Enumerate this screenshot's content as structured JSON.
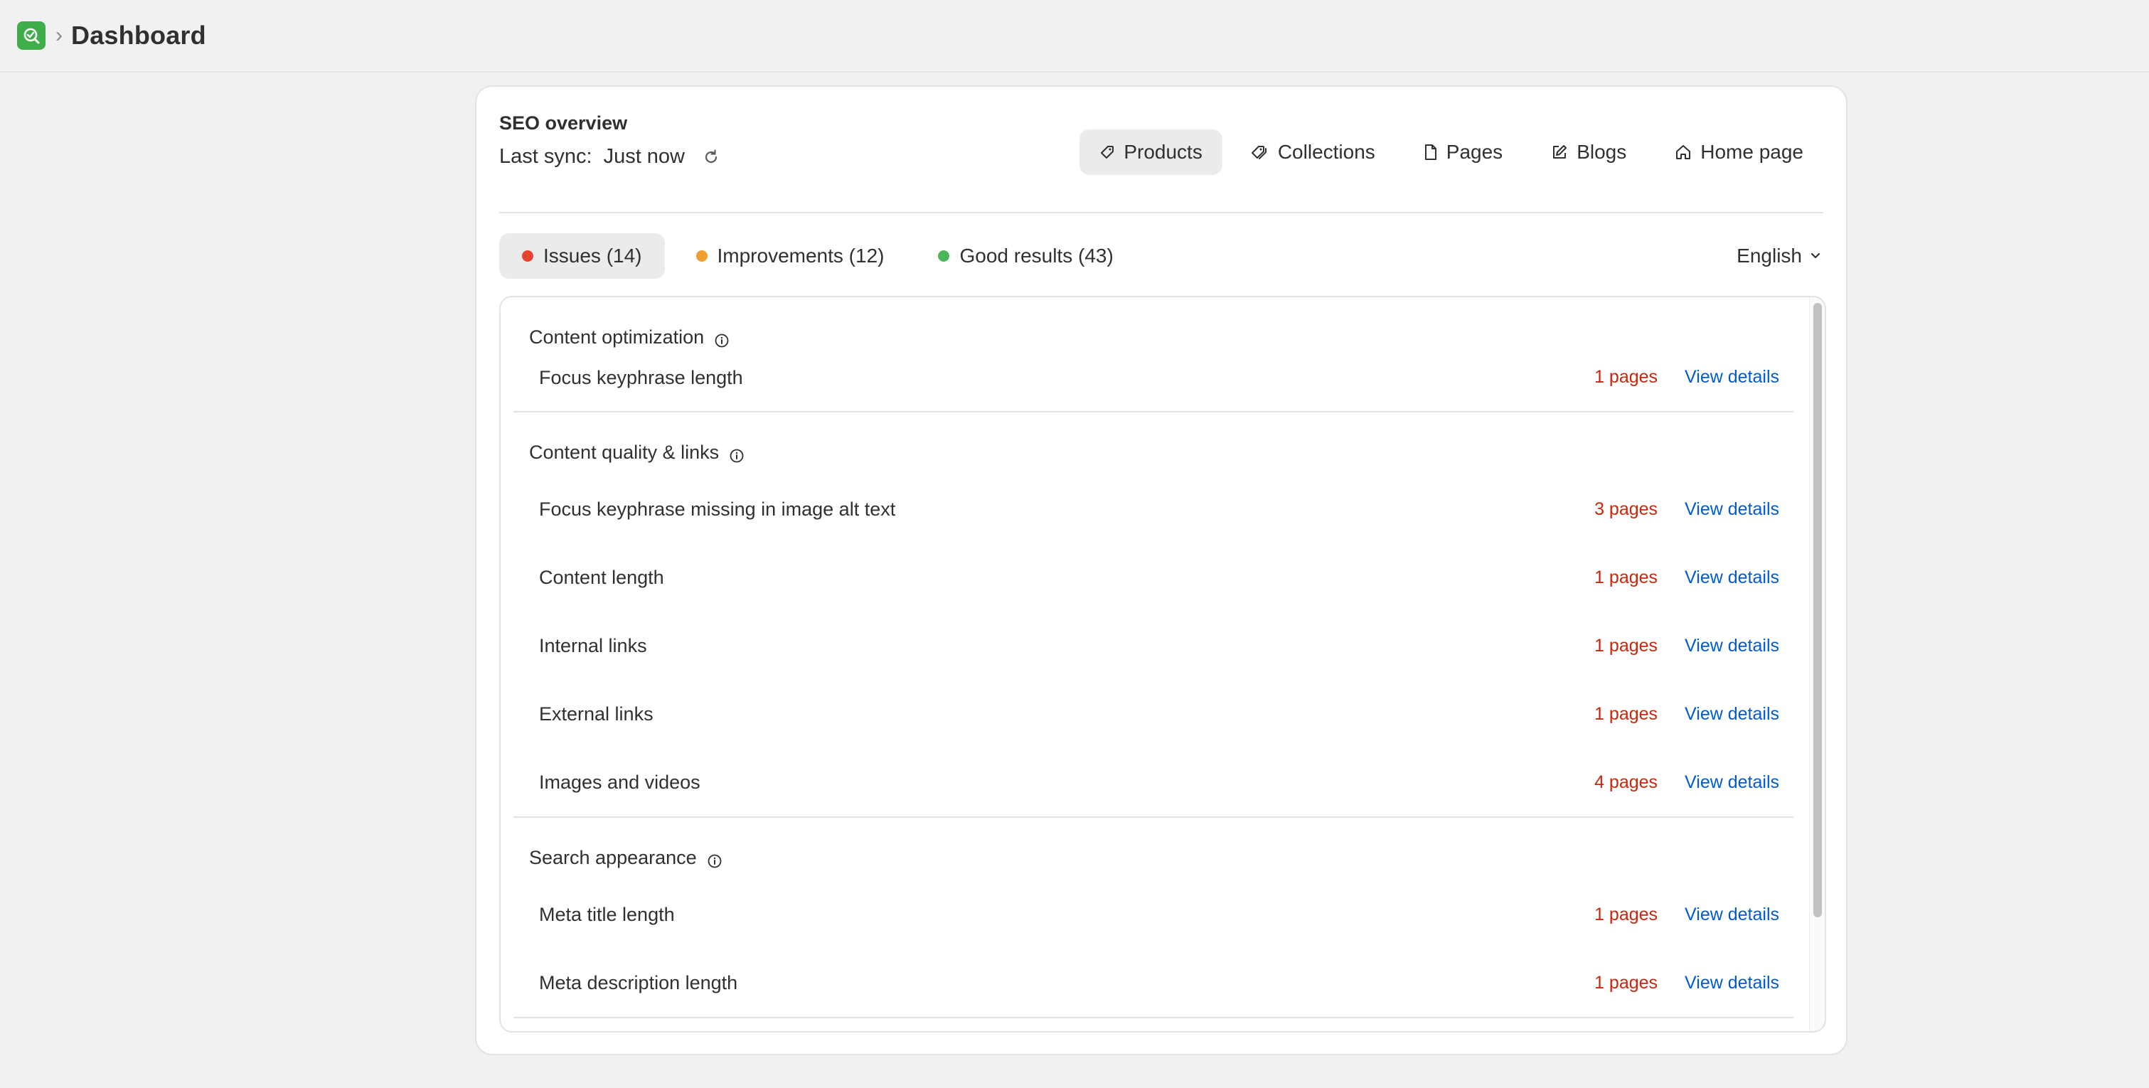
{
  "header": {
    "breadcrumb_sep": "›",
    "title": "Dashboard",
    "logo_icon": "app-logo-icon",
    "accent": "#3fae4a"
  },
  "overview": {
    "title": "SEO overview",
    "sync_label": "Last sync:",
    "sync_value": "Just now",
    "refresh_icon": "refresh-icon"
  },
  "type_tabs": [
    {
      "label": "Products",
      "icon": "tag-icon",
      "active": true
    },
    {
      "label": "Collections",
      "icon": "tags-icon",
      "active": false
    },
    {
      "label": "Pages",
      "icon": "page-icon",
      "active": false
    },
    {
      "label": "Blogs",
      "icon": "edit-icon",
      "active": false
    },
    {
      "label": "Home page",
      "icon": "home-icon",
      "active": false
    }
  ],
  "filter_tabs": [
    {
      "label": "Issues (14)",
      "color": "#e5432d",
      "active": true
    },
    {
      "label": "Improvements (12)",
      "color": "#f0a030",
      "active": false
    },
    {
      "label": "Good results (43)",
      "color": "#4cb65a",
      "active": false
    }
  ],
  "language": {
    "value": "English"
  },
  "sections": [
    {
      "title": "Content optimization",
      "items": [
        {
          "label": "Focus keyphrase length",
          "pages": "1 pages",
          "link": "View details"
        }
      ]
    },
    {
      "title": "Content quality & links",
      "items": [
        {
          "label": "Focus keyphrase missing in image alt text",
          "pages": "3 pages",
          "link": "View details"
        },
        {
          "label": "Content length",
          "pages": "1 pages",
          "link": "View details"
        },
        {
          "label": "Internal links",
          "pages": "1 pages",
          "link": "View details"
        },
        {
          "label": "External links",
          "pages": "1 pages",
          "link": "View details"
        },
        {
          "label": "Images and videos",
          "pages": "4 pages",
          "link": "View details"
        }
      ]
    },
    {
      "title": "Search appearance",
      "items": [
        {
          "label": "Meta title length",
          "pages": "1 pages",
          "link": "View details"
        },
        {
          "label": "Meta description length",
          "pages": "1 pages",
          "link": "View details"
        }
      ]
    }
  ]
}
